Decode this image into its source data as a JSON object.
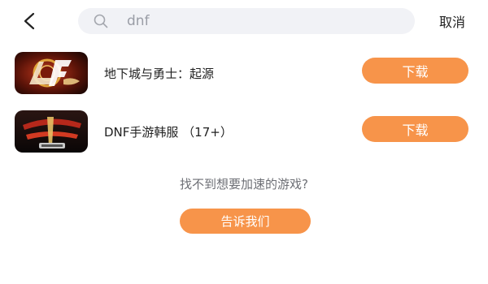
{
  "header": {
    "back_icon": "chevron-left-icon",
    "search": {
      "value": "dnf",
      "icon": "search-icon"
    },
    "cancel_label": "取消"
  },
  "results": [
    {
      "name": "地下城与勇士：起源",
      "download_label": "下载"
    },
    {
      "name": "DNF手游韩服 （17+）",
      "download_label": "下载"
    }
  ],
  "footer": {
    "hint": "找不到想要加速的游戏?",
    "tell_us_label": "告诉我们"
  },
  "colors": {
    "accent": "#f7944a",
    "search_bg": "#f1f2f6"
  }
}
